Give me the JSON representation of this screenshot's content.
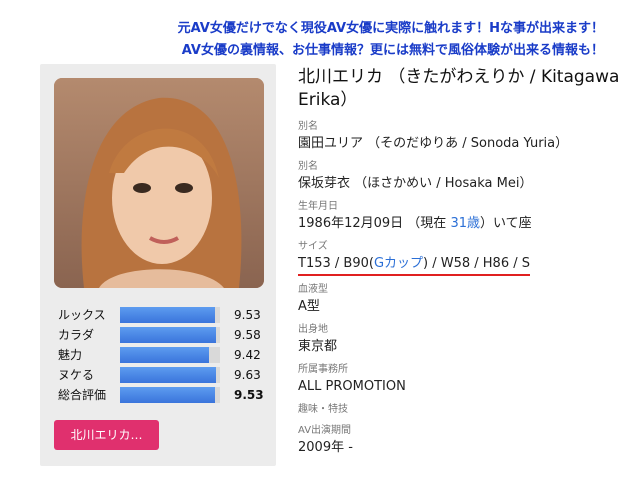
{
  "banner": {
    "line1": "元AV女優だけでなく現役AV女優に実際に触れます！Hな事が出来ます！",
    "line2": "AV女優の裏情報、お仕事情報？更には無料で風俗体験が出来る情報も！"
  },
  "profile": {
    "name": "北川エリカ （きたがわえりか / Kitagawa Erika）",
    "alias1_label": "別名",
    "alias1_value": "園田ユリア （そのだゆりあ / Sonoda Yuria）",
    "alias2_label": "別名",
    "alias2_value": "保坂芽衣 （ほさかめい / Hosaka Mei）",
    "birth_label": "生年月日",
    "birth_prefix": "1986年12月09日 （現在 ",
    "birth_age": "31歳",
    "birth_suffix": "）いて座",
    "size_label": "サイズ",
    "size_prefix": "T153 / B90(",
    "size_cup": "Gカップ",
    "size_suffix": ") / W58 / H86 / S",
    "blood_label": "血液型",
    "blood_value": "A型",
    "origin_label": "出身地",
    "origin_value": "東京都",
    "agency_label": "所属事務所",
    "agency_value": "ALL PROMOTION",
    "hobby_label": "趣味・特技",
    "period_label": "AV出演期間",
    "period_value": "2009年 -"
  },
  "ratings": [
    {
      "label": "ルックス",
      "value": "9.53",
      "fraction": 0.953
    },
    {
      "label": "カラダ",
      "value": "9.58",
      "fraction": 0.958
    },
    {
      "label": "魅力",
      "value": "9.42",
      "fraction": 0.89
    },
    {
      "label": "ヌケる",
      "value": "9.63",
      "fraction": 0.963
    },
    {
      "label": "総合評価",
      "value": "9.53",
      "fraction": 0.953
    }
  ],
  "button": {
    "label": "北川エリカ…"
  },
  "colors": {
    "banner": "#1a3cc8",
    "bar": "#3a74db",
    "button": "#e0306e",
    "link": "#2b6fd6",
    "underline": "#e02020"
  }
}
